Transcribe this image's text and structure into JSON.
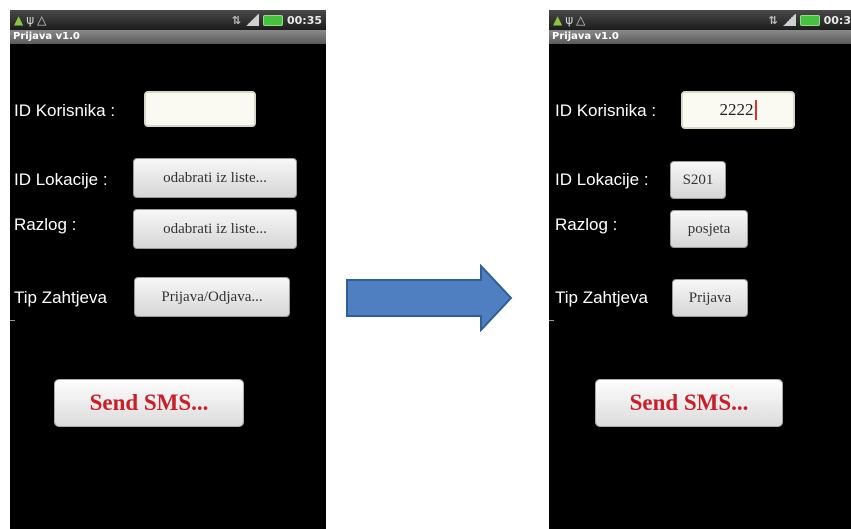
{
  "left_screen": {
    "status_time": "00:35",
    "app_title": "Prijava v1.0",
    "user_id_label": "ID Korisnika :",
    "user_id_value": "",
    "location_label": "ID Lokacije :",
    "location_button": "odabrati iz liste...",
    "reason_label": "Razlog :",
    "reason_button": "odabrati iz liste...",
    "request_type_label": "Tip Zahtjeva",
    "request_type_button": "Prijava/Odjava...",
    "send_button": "Send SMS..."
  },
  "right_screen": {
    "status_time": "00:3",
    "app_title": "Prijava v1.0",
    "user_id_label": "ID Korisnika :",
    "user_id_value": "2222",
    "location_label": "ID Lokacije :",
    "location_button": "S201",
    "reason_label": "Razlog :",
    "reason_button": "posjeta",
    "request_type_label": "Tip Zahtjeva",
    "request_type_button": "Prijava",
    "send_button": "Send SMS..."
  },
  "colors": {
    "arrow_fill": "#4f7fc0",
    "arrow_stroke": "#2f5f98",
    "send_text": "#c8202a",
    "screen_background": "#000000"
  },
  "icons": [
    "android-icon",
    "usb-icon",
    "wifi-icon",
    "signal-icon",
    "battery-icon",
    "right-arrow-icon"
  ]
}
